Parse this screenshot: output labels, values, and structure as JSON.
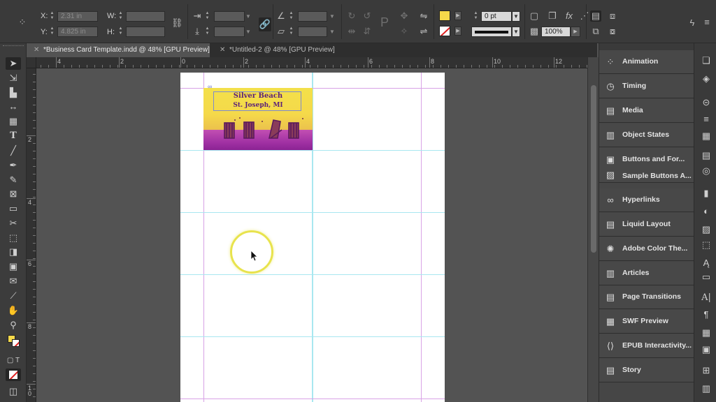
{
  "control_bar": {
    "x_label": "X:",
    "x_value": "2.31 in",
    "y_label": "Y:",
    "y_value": "4.825 in",
    "w_label": "W:",
    "w_value": "",
    "h_label": "H:",
    "h_value": "",
    "stroke_weight": "0 pt",
    "opacity": "100%",
    "fill_color": "#f5d94a"
  },
  "tabs": [
    {
      "label": "*Business Card Template.indd @ 48% [GPU Preview]",
      "active": true
    },
    {
      "label": "*Untitled-2 @ 48% [GPU Preview]",
      "active": false
    }
  ],
  "ruler_h_labels": [
    "4",
    "2",
    "0",
    "2",
    "4",
    "6",
    "8",
    "10",
    "12"
  ],
  "ruler_v_labels": [
    "2",
    "4",
    "6",
    "8",
    "1\n0"
  ],
  "card": {
    "line1": "Silver Beach",
    "line2": "St. Joseph, MI"
  },
  "panels": [
    {
      "label": "Animation",
      "icon": "animation-icon"
    },
    {
      "label": "Timing",
      "icon": "timing-icon"
    },
    {
      "label": "Media",
      "icon": "media-icon"
    },
    {
      "label": "Object States",
      "icon": "object-states-icon"
    },
    {
      "label": "Buttons and For...",
      "icon": "buttons-icon",
      "label2": "Sample Buttons A...",
      "icon2": "sample-buttons-icon"
    },
    {
      "label": "Hyperlinks",
      "icon": "hyperlinks-icon"
    },
    {
      "label": "Liquid Layout",
      "icon": "liquid-layout-icon"
    },
    {
      "label": "Adobe Color The...",
      "icon": "color-themes-icon"
    },
    {
      "label": "Articles",
      "icon": "articles-icon"
    },
    {
      "label": "Page Transitions",
      "icon": "page-transitions-icon"
    },
    {
      "label": "SWF Preview",
      "icon": "swf-preview-icon"
    },
    {
      "label": "EPUB Interactivity...",
      "icon": "epub-icon"
    },
    {
      "label": "Story",
      "icon": "story-icon"
    }
  ]
}
